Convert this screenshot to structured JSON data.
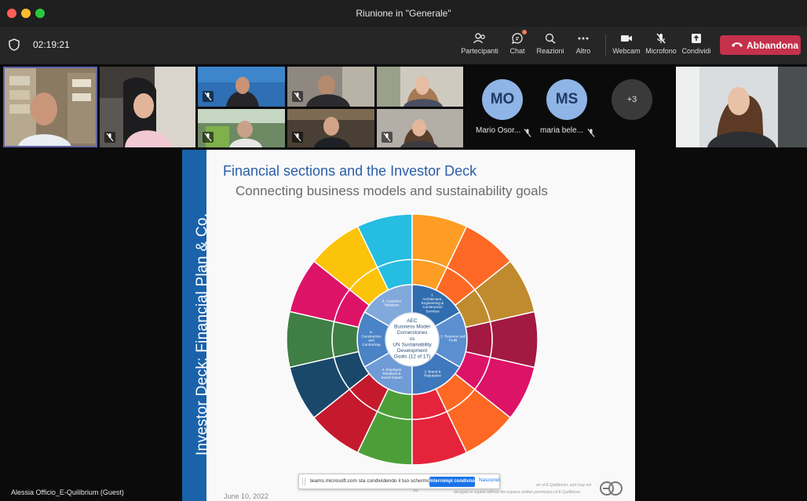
{
  "window": {
    "title": "Riunione in \"Generale\""
  },
  "toolbar": {
    "timer": "02:19:21",
    "buttons": [
      {
        "label": "Partecipanti",
        "icon": "people-icon"
      },
      {
        "label": "Chat",
        "icon": "chat-icon"
      },
      {
        "label": "Reazioni",
        "icon": "reactions-icon"
      },
      {
        "label": "Altro",
        "icon": "more-icon"
      },
      {
        "label": "Webcam",
        "icon": "camera-icon"
      },
      {
        "label": "Microfono",
        "icon": "mic-muted-icon"
      },
      {
        "label": "Condividi",
        "icon": "share-icon"
      }
    ],
    "leave_label": "Abbandona"
  },
  "participants": {
    "avatars": [
      {
        "initials": "MO",
        "name": "Mario Osor...",
        "color": "#8fb4e6"
      },
      {
        "initials": "MS",
        "name": "maria bele...",
        "color": "#8fb4e6"
      }
    ],
    "overflow": "+3"
  },
  "slide": {
    "side_title": "Investor Deck: Financial Plan & Co.",
    "title": "Financial sections and the Investor Deck",
    "subtitle": "Connecting business models and sustainability goals",
    "center_text": [
      "AEC",
      "Business Model",
      "Cornerstones",
      "vs",
      "UN Sustainability",
      "Development",
      "Goals (12 of 17)"
    ],
    "inner_labels": [
      "1. Architecture, Engineering & Construction Services",
      "2. Revenue and Profit",
      "3. Brand & Reputation",
      "4. Employee Relations & Social Impact",
      "5. Construction and Contracting",
      "6. Customer Relations"
    ],
    "date": "June 10, 2022",
    "page": "32",
    "footer_line1": "on of E-Quilibrium, and may not",
    "footer_line2": "divulged or copied without the express written permission of E-Quilibrium."
  },
  "share_bar": {
    "message": "teams.microsoft.com sta condividendo il tuo schermo.",
    "stop_label": "Interrompi condivisione",
    "hide_label": "Nascondi"
  },
  "presenter_name": "Alessia Officio_E-Quilibrium (Guest)",
  "colors": {
    "leave": "#c4314b",
    "slide_bar": "#1a62aa",
    "share_button": "#1a73e8"
  }
}
